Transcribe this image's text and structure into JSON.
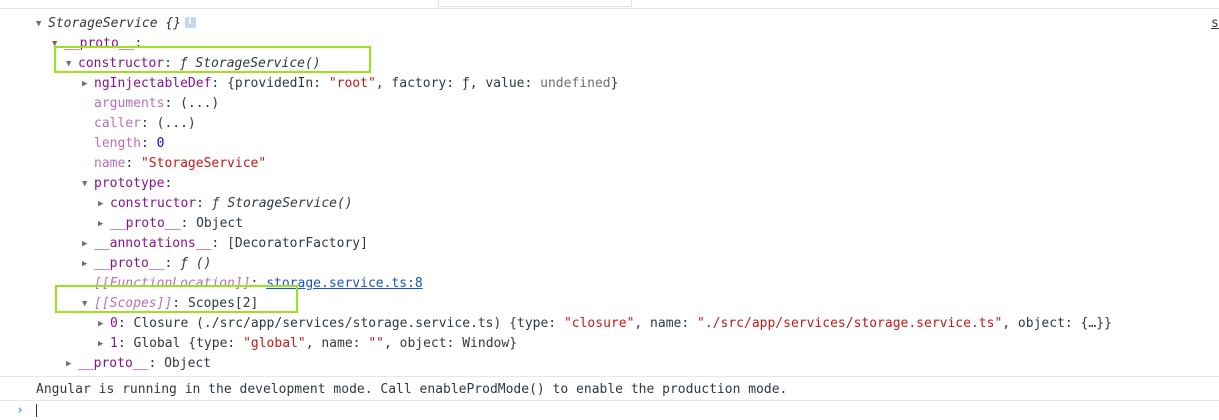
{
  "console": {
    "root_label": "StorageService {}",
    "side_link": "s",
    "tree": {
      "proto1": "__proto__",
      "constructor_key": "constructor",
      "constructor_val": "ƒ StorageService()",
      "ngInjectableDef_key": "ngInjectableDef",
      "ngInjectableDef_val_pre": "{providedIn: ",
      "ngInjectableDef_root": "\"root\"",
      "ngInjectableDef_val_mid": ", factory: ƒ, value: ",
      "ngInjectableDef_undefined": "undefined",
      "ngInjectableDef_val_end": "}",
      "arguments_key": "arguments",
      "arguments_val": "(...)",
      "caller_key": "caller",
      "caller_val": "(...)",
      "length_key": "length",
      "length_val": "0",
      "name_key": "name",
      "name_val": "\"StorageService\"",
      "prototype_key": "prototype",
      "proto_constructor_key": "constructor",
      "proto_constructor_val": "ƒ StorageService()",
      "proto_proto_key": "__proto__",
      "proto_proto_val": "Object",
      "annotations_key": "__annotations__",
      "annotations_val": "[DecoratorFactory]",
      "fn_proto_key": "__proto__",
      "fn_proto_val": "ƒ ()",
      "function_location_key": "[[FunctionLocation]]",
      "function_location_val": "storage.service.ts:8",
      "scopes_key": "[[Scopes]]",
      "scopes_val": "Scopes[2]",
      "scope0_idx": "0",
      "scope0_pre": "Closure (./src/app/services/storage.service.ts) {type: ",
      "scope0_type": "\"closure\"",
      "scope0_mid": ", name: ",
      "scope0_name": "\"./src/app/services/storage.service.ts\"",
      "scope0_end": ", object: {…}}",
      "scope1_idx": "1",
      "scope1_pre": "Global {type: ",
      "scope1_type": "\"global\"",
      "scope1_mid": ", name: ",
      "scope1_name": "\"\"",
      "scope1_end": ", object: Window}",
      "outer_proto_key": "__proto__",
      "outer_proto_val": "Object"
    },
    "message": "Angular is running in the development mode. Call enableProdMode() to enable the production mode.",
    "prompt_symbol": "›"
  },
  "colors": {
    "highlight": "#9be31b",
    "key": "#881391",
    "string": "#c41a16",
    "number": "#1c00cf",
    "link": "#1a55c6"
  },
  "icons": [
    "expand-triangle-icon",
    "collapse-triangle-icon",
    "info-icon",
    "prompt-chevron-icon"
  ]
}
